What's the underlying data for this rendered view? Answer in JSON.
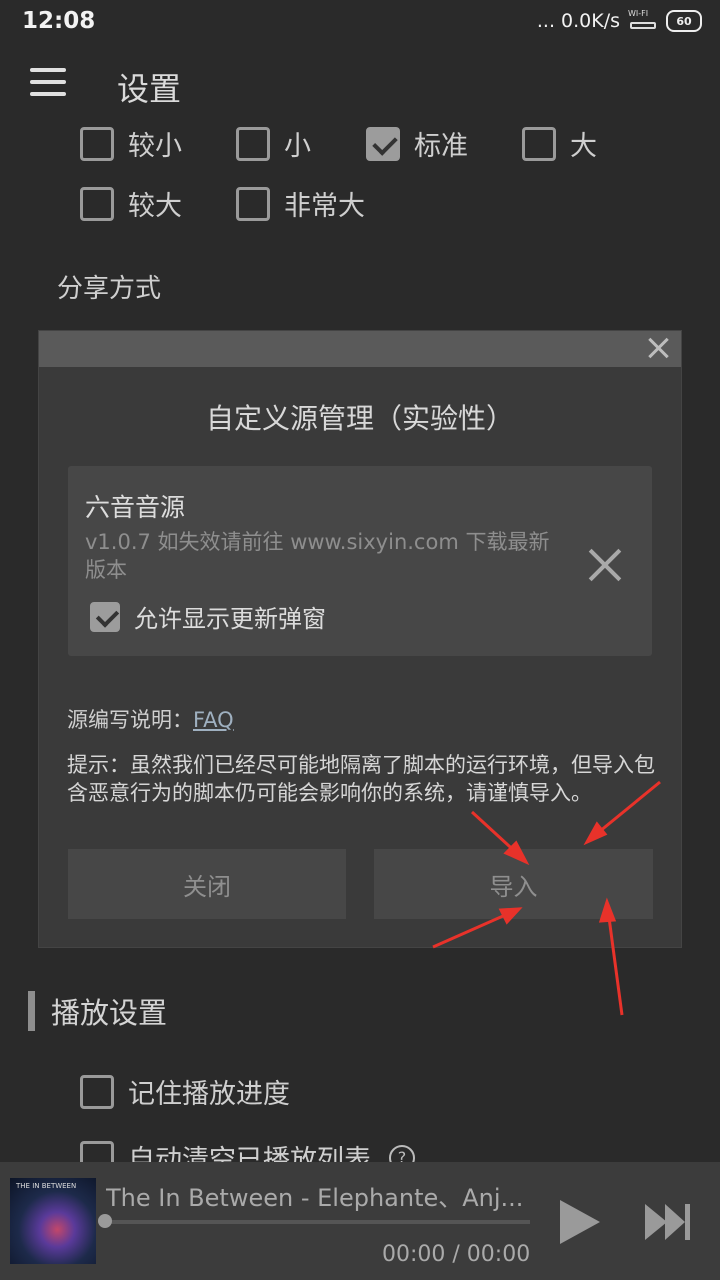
{
  "status": {
    "time": "12:08",
    "network": "... 0.0K/s",
    "wifi": "WI-FI",
    "battery": "60"
  },
  "appbar": {
    "title": "设置"
  },
  "font_size": {
    "options": [
      {
        "label": "较小",
        "checked": false
      },
      {
        "label": "小",
        "checked": false
      },
      {
        "label": "标准",
        "checked": true
      },
      {
        "label": "大",
        "checked": false
      },
      {
        "label": "较大",
        "checked": false
      },
      {
        "label": "非常大",
        "checked": false
      }
    ]
  },
  "share_section": {
    "label": "分享方式"
  },
  "playback_section": {
    "title": "播放设置",
    "remember_progress": "记住播放进度",
    "auto_clear": "自动清空已播放列表"
  },
  "dialog": {
    "title": "自定义源管理（实验性）",
    "source": {
      "name": "六音音源",
      "description": "v1.0.7 如失效请前往 www.sixyin.com 下载最新版本",
      "allow_update_popup": "允许显示更新弹窗"
    },
    "faq_prefix": "源编写说明：",
    "faq_link": "FAQ",
    "tip": "提示：虽然我们已经尽可能地隔离了脚本的运行环境，但导入包含恶意行为的脚本仍可能会影响你的系统，请谨慎导入。",
    "close_button": "关闭",
    "import_button": "导入"
  },
  "player": {
    "track": "The In Between - Elephante、Anj...",
    "time": "00:00 / 00:00",
    "cover_text": "THE IN BETWEEN"
  },
  "colors": {
    "annotation_arrow": "#e8322a"
  }
}
